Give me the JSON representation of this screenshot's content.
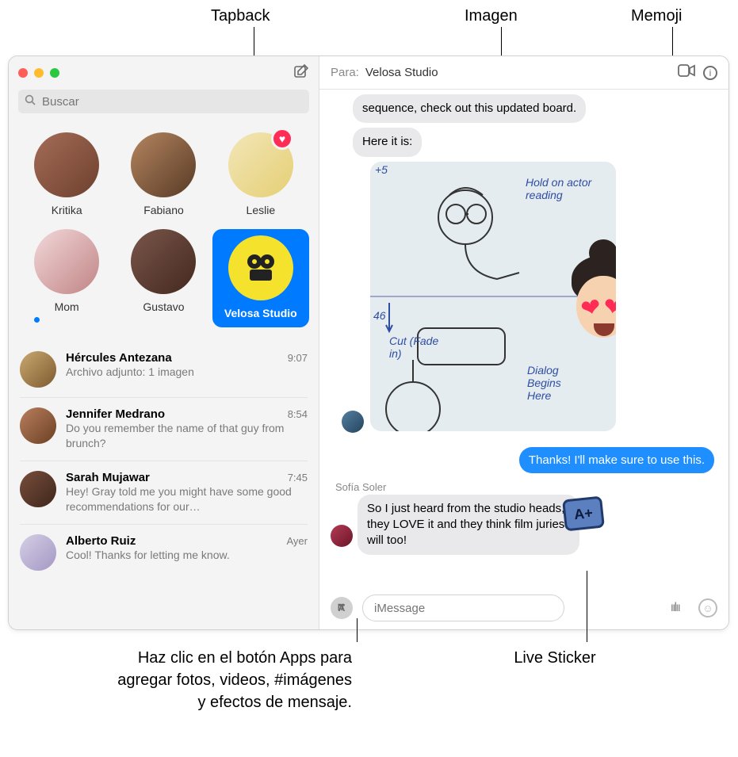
{
  "callouts": {
    "tapback": "Tapback",
    "imagen": "Imagen",
    "memoji": "Memoji",
    "apps": "Haz clic en el botón Apps para agregar fotos, videos, #imágenes y efectos de mensaje.",
    "sticker": "Live Sticker"
  },
  "search_placeholder": "Buscar",
  "pins": [
    {
      "label": "Kritika"
    },
    {
      "label": "Fabiano"
    },
    {
      "label": "Leslie"
    },
    {
      "label": "Mom"
    },
    {
      "label": "Gustavo"
    },
    {
      "label": "Velosa Studio"
    }
  ],
  "tapback_icon": "♥",
  "conversations": [
    {
      "name": "Hércules Antezana",
      "preview": "Archivo adjunto:  1 imagen",
      "time": "9:07"
    },
    {
      "name": "Jennifer Medrano",
      "preview": "Do you remember the name of that guy from brunch?",
      "time": "8:54"
    },
    {
      "name": "Sarah Mujawar",
      "preview": "Hey! Gray told me you might have some good recommendations for our…",
      "time": "7:45"
    },
    {
      "name": "Alberto Ruiz",
      "preview": "Cool! Thanks for letting me know.",
      "time": "Ayer"
    }
  ],
  "header": {
    "to_label": "Para:",
    "to_value": "Velosa Studio"
  },
  "messages": {
    "in1": "sequence, check out this updated board.",
    "in2": "Here it is:",
    "out1": "Thanks! I'll make sure to use this.",
    "sofia_name": "Sofía Soler",
    "sofia": "So I just heard from the studio heads, they LOVE it and they think film juries will too!"
  },
  "image_annotations": {
    "hold": "Hold on actor reading",
    "cut": "Cut (Fade in)",
    "dialog": "Dialog Begins Here",
    "a5": "+5",
    "a46": "46"
  },
  "sticker_text": "A+",
  "compose": {
    "placeholder": "iMessage"
  }
}
